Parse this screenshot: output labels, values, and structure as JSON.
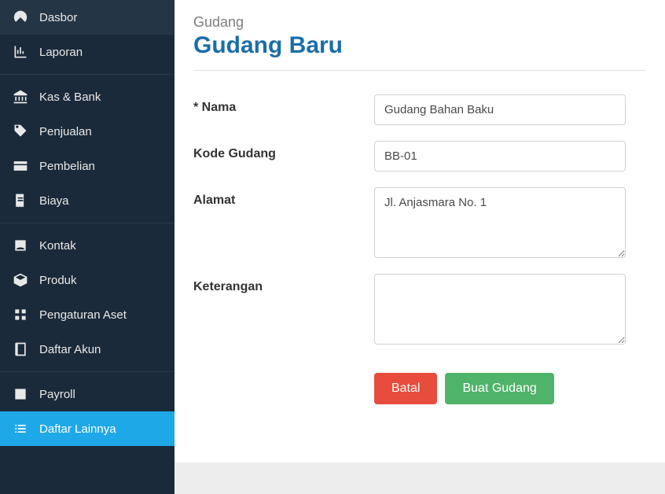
{
  "sidebar": {
    "items": [
      {
        "label": "Dasbor",
        "name": "sidebar-item-dasbor",
        "icon": "dashboard-icon"
      },
      {
        "label": "Laporan",
        "name": "sidebar-item-laporan",
        "icon": "chart-icon"
      },
      {
        "label": "Kas & Bank",
        "name": "sidebar-item-kas-bank",
        "icon": "bank-icon"
      },
      {
        "label": "Penjualan",
        "name": "sidebar-item-penjualan",
        "icon": "tag-icon"
      },
      {
        "label": "Pembelian",
        "name": "sidebar-item-pembelian",
        "icon": "card-icon"
      },
      {
        "label": "Biaya",
        "name": "sidebar-item-biaya",
        "icon": "receipt-icon"
      },
      {
        "label": "Kontak",
        "name": "sidebar-item-kontak",
        "icon": "contact-icon"
      },
      {
        "label": "Produk",
        "name": "sidebar-item-produk",
        "icon": "box-icon"
      },
      {
        "label": "Pengaturan Aset",
        "name": "sidebar-item-pengaturan-aset",
        "icon": "asset-icon"
      },
      {
        "label": "Daftar Akun",
        "name": "sidebar-item-daftar-akun",
        "icon": "book-icon"
      },
      {
        "label": "Payroll",
        "name": "sidebar-item-payroll",
        "icon": "payroll-icon"
      },
      {
        "label": "Daftar Lainnya",
        "name": "sidebar-item-daftar-lainnya",
        "icon": "list-icon"
      }
    ]
  },
  "header": {
    "breadcrumb": "Gudang",
    "title": "Gudang Baru"
  },
  "form": {
    "nama": {
      "label": "* Nama",
      "value": "Gudang Bahan Baku"
    },
    "kode": {
      "label": "Kode Gudang",
      "value": "BB-01"
    },
    "alamat": {
      "label": "Alamat",
      "value": "Jl. Anjasmara No. 1"
    },
    "keterangan": {
      "label": "Keterangan",
      "value": ""
    }
  },
  "buttons": {
    "cancel": "Batal",
    "submit": "Buat Gudang"
  }
}
